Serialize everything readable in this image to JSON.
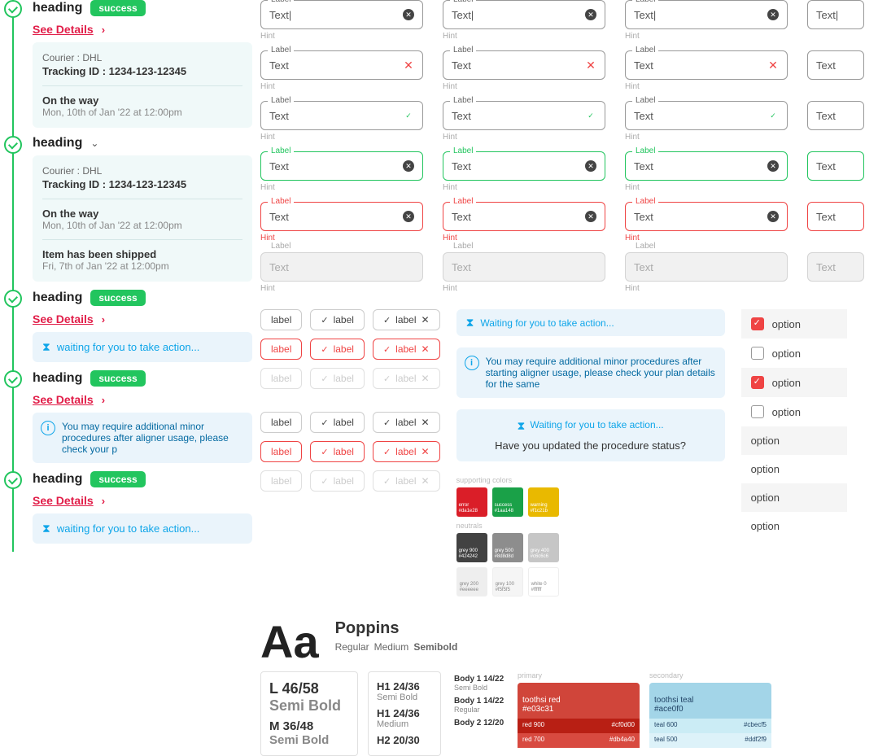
{
  "tracking": {
    "heading": "heading",
    "success_badge": "success",
    "see_details": "See Details",
    "courier_label": "Courier : DHL",
    "tracking_label": "Tracking ID : 1234-123-12345",
    "status1_title": "On the way",
    "status1_date": "Mon, 10th of Jan '22 at 12:00pm",
    "status2_title": "Item has been shipped",
    "status2_date": "Fri, 7th of Jan '22 at 12:00pm",
    "waiting_text": "waiting for you to take action...",
    "info_text": "You may require additional minor procedures after aligner usage, please check your p"
  },
  "field": {
    "label": "Label",
    "text": "Text",
    "text_cursor": "Text|",
    "hint": "Hint"
  },
  "chip": {
    "label": "label"
  },
  "messages": {
    "waiting": "Waiting for you to take action...",
    "info": "You may require additional minor procedures after starting aligner usage, please check your plan details for the same",
    "question": "Have you updated the procedure status?"
  },
  "options": {
    "label": "option"
  },
  "swatches": {
    "supporting": "supporting colors",
    "neutrals": "neutrals",
    "error": {
      "name": "error",
      "hex": "#da1e28"
    },
    "success": {
      "name": "success",
      "hex": "#1aa148"
    },
    "warning": {
      "name": "warning",
      "hex": "#f1c21b"
    },
    "grey900": {
      "name": "grey 900",
      "hex": "#424242"
    },
    "grey500": {
      "name": "grey 500",
      "hex": "#8d8d8d"
    },
    "grey400": {
      "name": "grey 400",
      "hex": "#c6c6c6"
    },
    "grey200": {
      "name": "grey 200",
      "hex": "#eeeeee"
    },
    "grey100": {
      "name": "grey 100",
      "hex": "#f5f5f5"
    },
    "white": {
      "name": "white 0",
      "hex": "#ffffff"
    }
  },
  "typo": {
    "aa": "Aa",
    "name": "Poppins",
    "w1": "Regular",
    "w2": "Medium",
    "w3": "Semibold",
    "l": "L 46/58",
    "semi": "Semi Bold",
    "m": "M 36/48",
    "h1": "H1 24/36",
    "h1s": "Semi Bold",
    "h1m": "H1 24/36",
    "h1ms": "Medium",
    "h2": "H2 20/30",
    "b1a": "Body 1 14/22",
    "b1as": "Semi Bold",
    "b1b": "Body 1 14/22",
    "b1bs": "Regular",
    "b2": "Body 2 12/20"
  },
  "colors": {
    "primary": "primary",
    "secondary": "secondary",
    "red": {
      "name": "toothsi red",
      "hex": "#e03c31"
    },
    "red900": {
      "name": "red 900",
      "hex": "#cf0d00"
    },
    "red700": {
      "name": "red 700",
      "hex": "#db4a40"
    },
    "teal": {
      "name": "toothsi teal",
      "hex": "#ace0f0"
    },
    "teal600": {
      "name": "teal 600",
      "hex": "#cbecf5"
    },
    "teal500": {
      "name": "teal 500",
      "hex": "#ddf2f9"
    }
  }
}
